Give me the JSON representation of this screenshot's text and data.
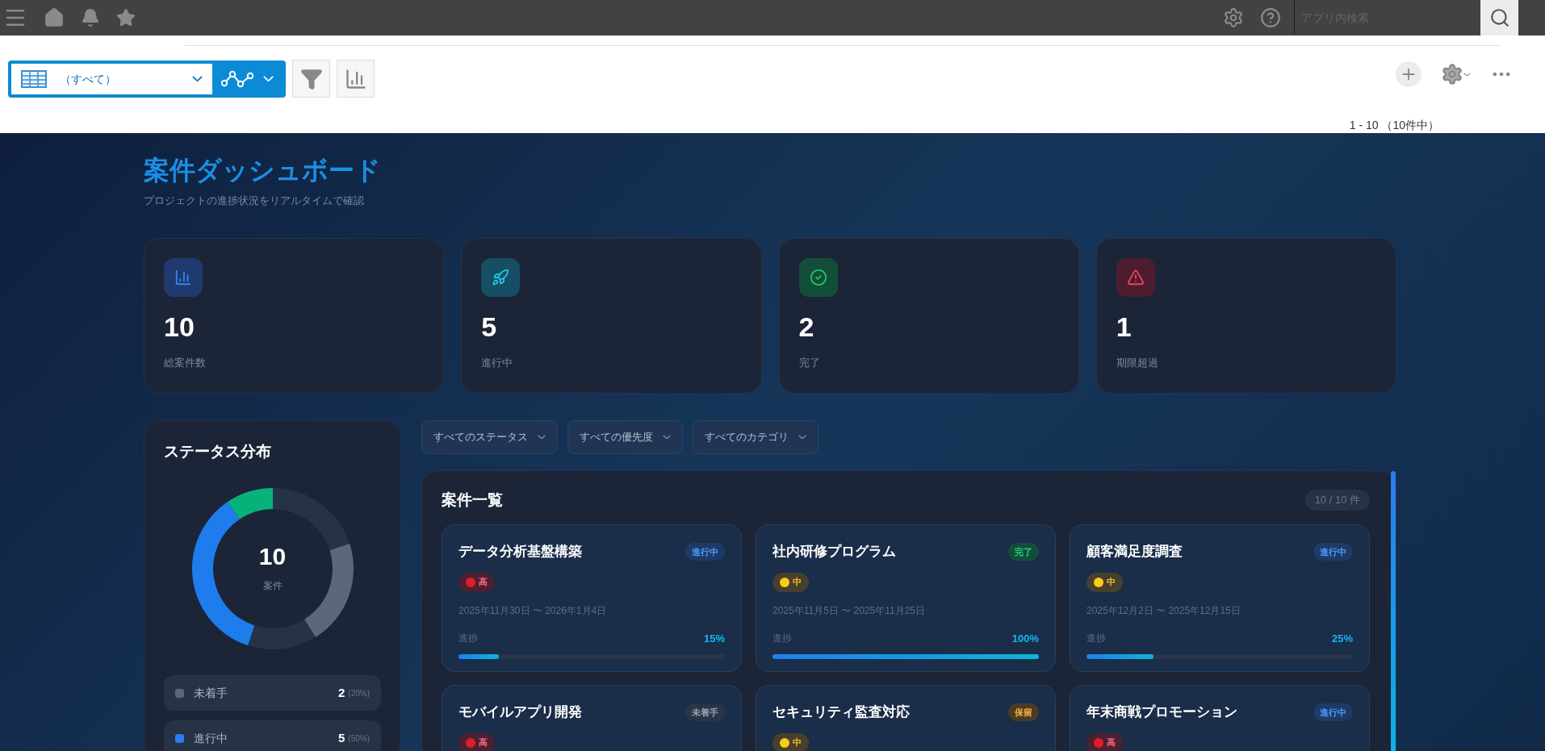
{
  "top_bar": {
    "search": {
      "placeholder": "アプリ内検索"
    }
  },
  "toolbar": {
    "view_select": {
      "value": "（すべて）"
    },
    "record_range": "1 - 10 （10件中）"
  },
  "dashboard": {
    "title": "案件ダッシュボード",
    "subtitle": "プロジェクトの進捗状況をリアルタイムで確認",
    "stats": [
      {
        "kind": "total",
        "value": "10",
        "label": "総案件数"
      },
      {
        "kind": "active",
        "value": "5",
        "label": "進行中"
      },
      {
        "kind": "done",
        "value": "2",
        "label": "完了"
      },
      {
        "kind": "overdue",
        "value": "1",
        "label": "期限超過"
      }
    ],
    "status_panel": {
      "title": "ステータス分布",
      "center_value": "10",
      "center_label": "案件",
      "legend": [
        {
          "label": "未着手",
          "count": "2",
          "percent": "(20%)",
          "color": "#5b687a"
        },
        {
          "label": "進行中",
          "count": "5",
          "percent": "(50%)",
          "color": "#2a7cf0"
        }
      ]
    },
    "filters": [
      "すべてのステータス",
      "すべての優先度",
      "すべてのカテゴリ"
    ],
    "list": {
      "title": "案件一覧",
      "count": "10 / 10 件",
      "projects": [
        {
          "name": "データ分析基盤構築",
          "status": {
            "label": "進行中",
            "kind": "active"
          },
          "priority": {
            "label": "高",
            "kind": "high"
          },
          "dates": "2025年11月30日 〜 2026年1月4日",
          "progress_label": "進捗",
          "percent": "15%",
          "level": 0.15
        },
        {
          "name": "社内研修プログラム",
          "status": {
            "label": "完了",
            "kind": "done"
          },
          "priority": {
            "label": "中",
            "kind": "mid"
          },
          "dates": "2025年11月5日 〜 2025年11月25日",
          "progress_label": "進捗",
          "percent": "100%",
          "level": 1
        },
        {
          "name": "顧客満足度調査",
          "status": {
            "label": "進行中",
            "kind": "active"
          },
          "priority": {
            "label": "中",
            "kind": "mid"
          },
          "dates": "2025年12月2日 〜 2025年12月15日",
          "progress_label": "進捗",
          "percent": "25%",
          "level": 0.25
        },
        {
          "name": "モバイルアプリ開発",
          "status": {
            "label": "未着手",
            "kind": "todo"
          },
          "priority": {
            "label": "高",
            "kind": "high"
          }
        },
        {
          "name": "セキュリティ監査対応",
          "status": {
            "label": "保留",
            "kind": "hold"
          },
          "priority": {
            "label": "中",
            "kind": "mid"
          }
        },
        {
          "name": "年末商戦プロモーション",
          "status": {
            "label": "進行中",
            "kind": "active"
          },
          "priority": {
            "label": "高",
            "kind": "high"
          }
        }
      ]
    }
  }
}
